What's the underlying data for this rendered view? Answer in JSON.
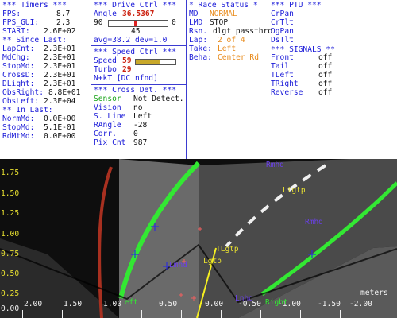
{
  "timers": {
    "header": "*** Timers ***",
    "rows": [
      {
        "label": "FPS:",
        "value": "8.7"
      },
      {
        "label": "FPS_GUI:",
        "value": "2.3"
      },
      {
        "label": "START:",
        "value": "2.6E+02"
      }
    ],
    "since_header": "** Since Last:",
    "since_rows": [
      {
        "label": "LapCnt:",
        "value": "2.3E+01"
      },
      {
        "label": "MdChg:",
        "value": "2.3E+01"
      },
      {
        "label": "StopMd:",
        "value": "2.3E+01"
      },
      {
        "label": "CrossD:",
        "value": "2.3E+01"
      },
      {
        "label": "DLight:",
        "value": "2.3E+01"
      },
      {
        "label": "ObsRight:",
        "value": "8.8E+01"
      },
      {
        "label": "ObsLeft:",
        "value": "2.3E+04"
      }
    ],
    "inlast_header": "** In Last:",
    "inlast_rows": [
      {
        "label": "NormMd:",
        "value": "0.0E+00"
      },
      {
        "label": "StopMd:",
        "value": "5.1E-01"
      },
      {
        "label": "RdMtMd:",
        "value": "0.0E+00"
      }
    ]
  },
  "drive": {
    "header": "*** Drive Ctrl ***",
    "angle_label": "Angle",
    "angle_value": "36.5367",
    "slider_min": "90",
    "slider_max": "0",
    "slider_position": 0.45,
    "slider_readout": "45",
    "avg": "avg=38.2  dev=1.0",
    "speed_header": "*** Speed Ctrl ***",
    "speed_label": "Speed",
    "speed_value": "59",
    "speed_fill": 0.59,
    "turbo_label": "Turbo",
    "turbo_value": "29",
    "turbo_fill": 0.29,
    "mode_line": "N+kT [DC nfnd]",
    "cross_header": "*** Cross Det. ***",
    "cross_rows": [
      {
        "label": "Sensor",
        "value": "Not Detect."
      },
      {
        "label": "Vision",
        "value": "no"
      },
      {
        "label": "S. Line",
        "value": "Left"
      },
      {
        "label": "RAngle",
        "value": "-28"
      },
      {
        "label": "Corr.",
        "value": "0"
      },
      {
        "label": "Pix Cnt",
        "value": "987"
      }
    ]
  },
  "race": {
    "header": "* Race Status *",
    "rows": [
      {
        "label": "MD",
        "value": "NORMAL"
      },
      {
        "label": "LMD",
        "value": "STOP"
      },
      {
        "label": "Rsn.",
        "value": "dlgt passthro"
      },
      {
        "label": "Lap:",
        "value": "2 of 4"
      },
      {
        "label": "Take:",
        "value": "Left"
      },
      {
        "label": "Beha:",
        "value": "Center Rd"
      }
    ]
  },
  "ptu": {
    "header": "*** PTU ***",
    "items": [
      "CrPan",
      "CrTlt",
      "DgPan",
      "DsTlt"
    ],
    "signals_header": "*** SIGNALS **",
    "signals": [
      {
        "label": "Front",
        "value": "off"
      },
      {
        "label": "Tail",
        "value": "off"
      },
      {
        "label": "TLeft",
        "value": "off"
      },
      {
        "label": "TRight",
        "value": "off"
      },
      {
        "label": "Reverse",
        "value": "off"
      }
    ]
  },
  "camera": {
    "y_ticks": [
      "1.75",
      "1.50",
      "1.25",
      "1.00",
      "0.75",
      "0.50",
      "0.25",
      "0.00"
    ],
    "x_ticks": [
      "2.00",
      "1.50",
      "1.00",
      "0.50",
      "0.00",
      "-0.50",
      "-1.00",
      "-1.50",
      "-2.00"
    ],
    "x_unit": "meters",
    "markers": {
      "left_line": "Left",
      "right_line": "Right",
      "ltgtp_top": "Ltgtp",
      "ltgtp_mid": "TLgtp",
      "ltgtp_low": "Lgtp",
      "lmhd": "Lmhd",
      "lnhd": "Lnhd",
      "rmhd": "Rmhd",
      "lrmhd": "Lrmhd",
      "roadtop": "Rmhd"
    },
    "colors": {
      "lane": "#2fe62f",
      "marker": "#e8e030",
      "overlay": "#6a40e8",
      "grid": "#f0f0f0"
    }
  }
}
